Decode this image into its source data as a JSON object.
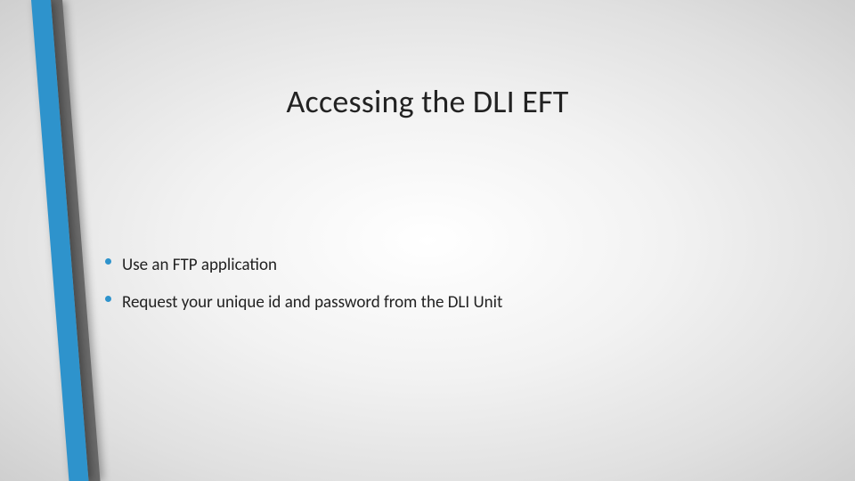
{
  "title": "Accessing the DLI EFT",
  "bullets": [
    "Use an FTP application",
    "Request your unique id and password from the DLI Unit"
  ],
  "accent_colors": {
    "blue": "#2e93cc",
    "gray": "#6a6a6a"
  }
}
